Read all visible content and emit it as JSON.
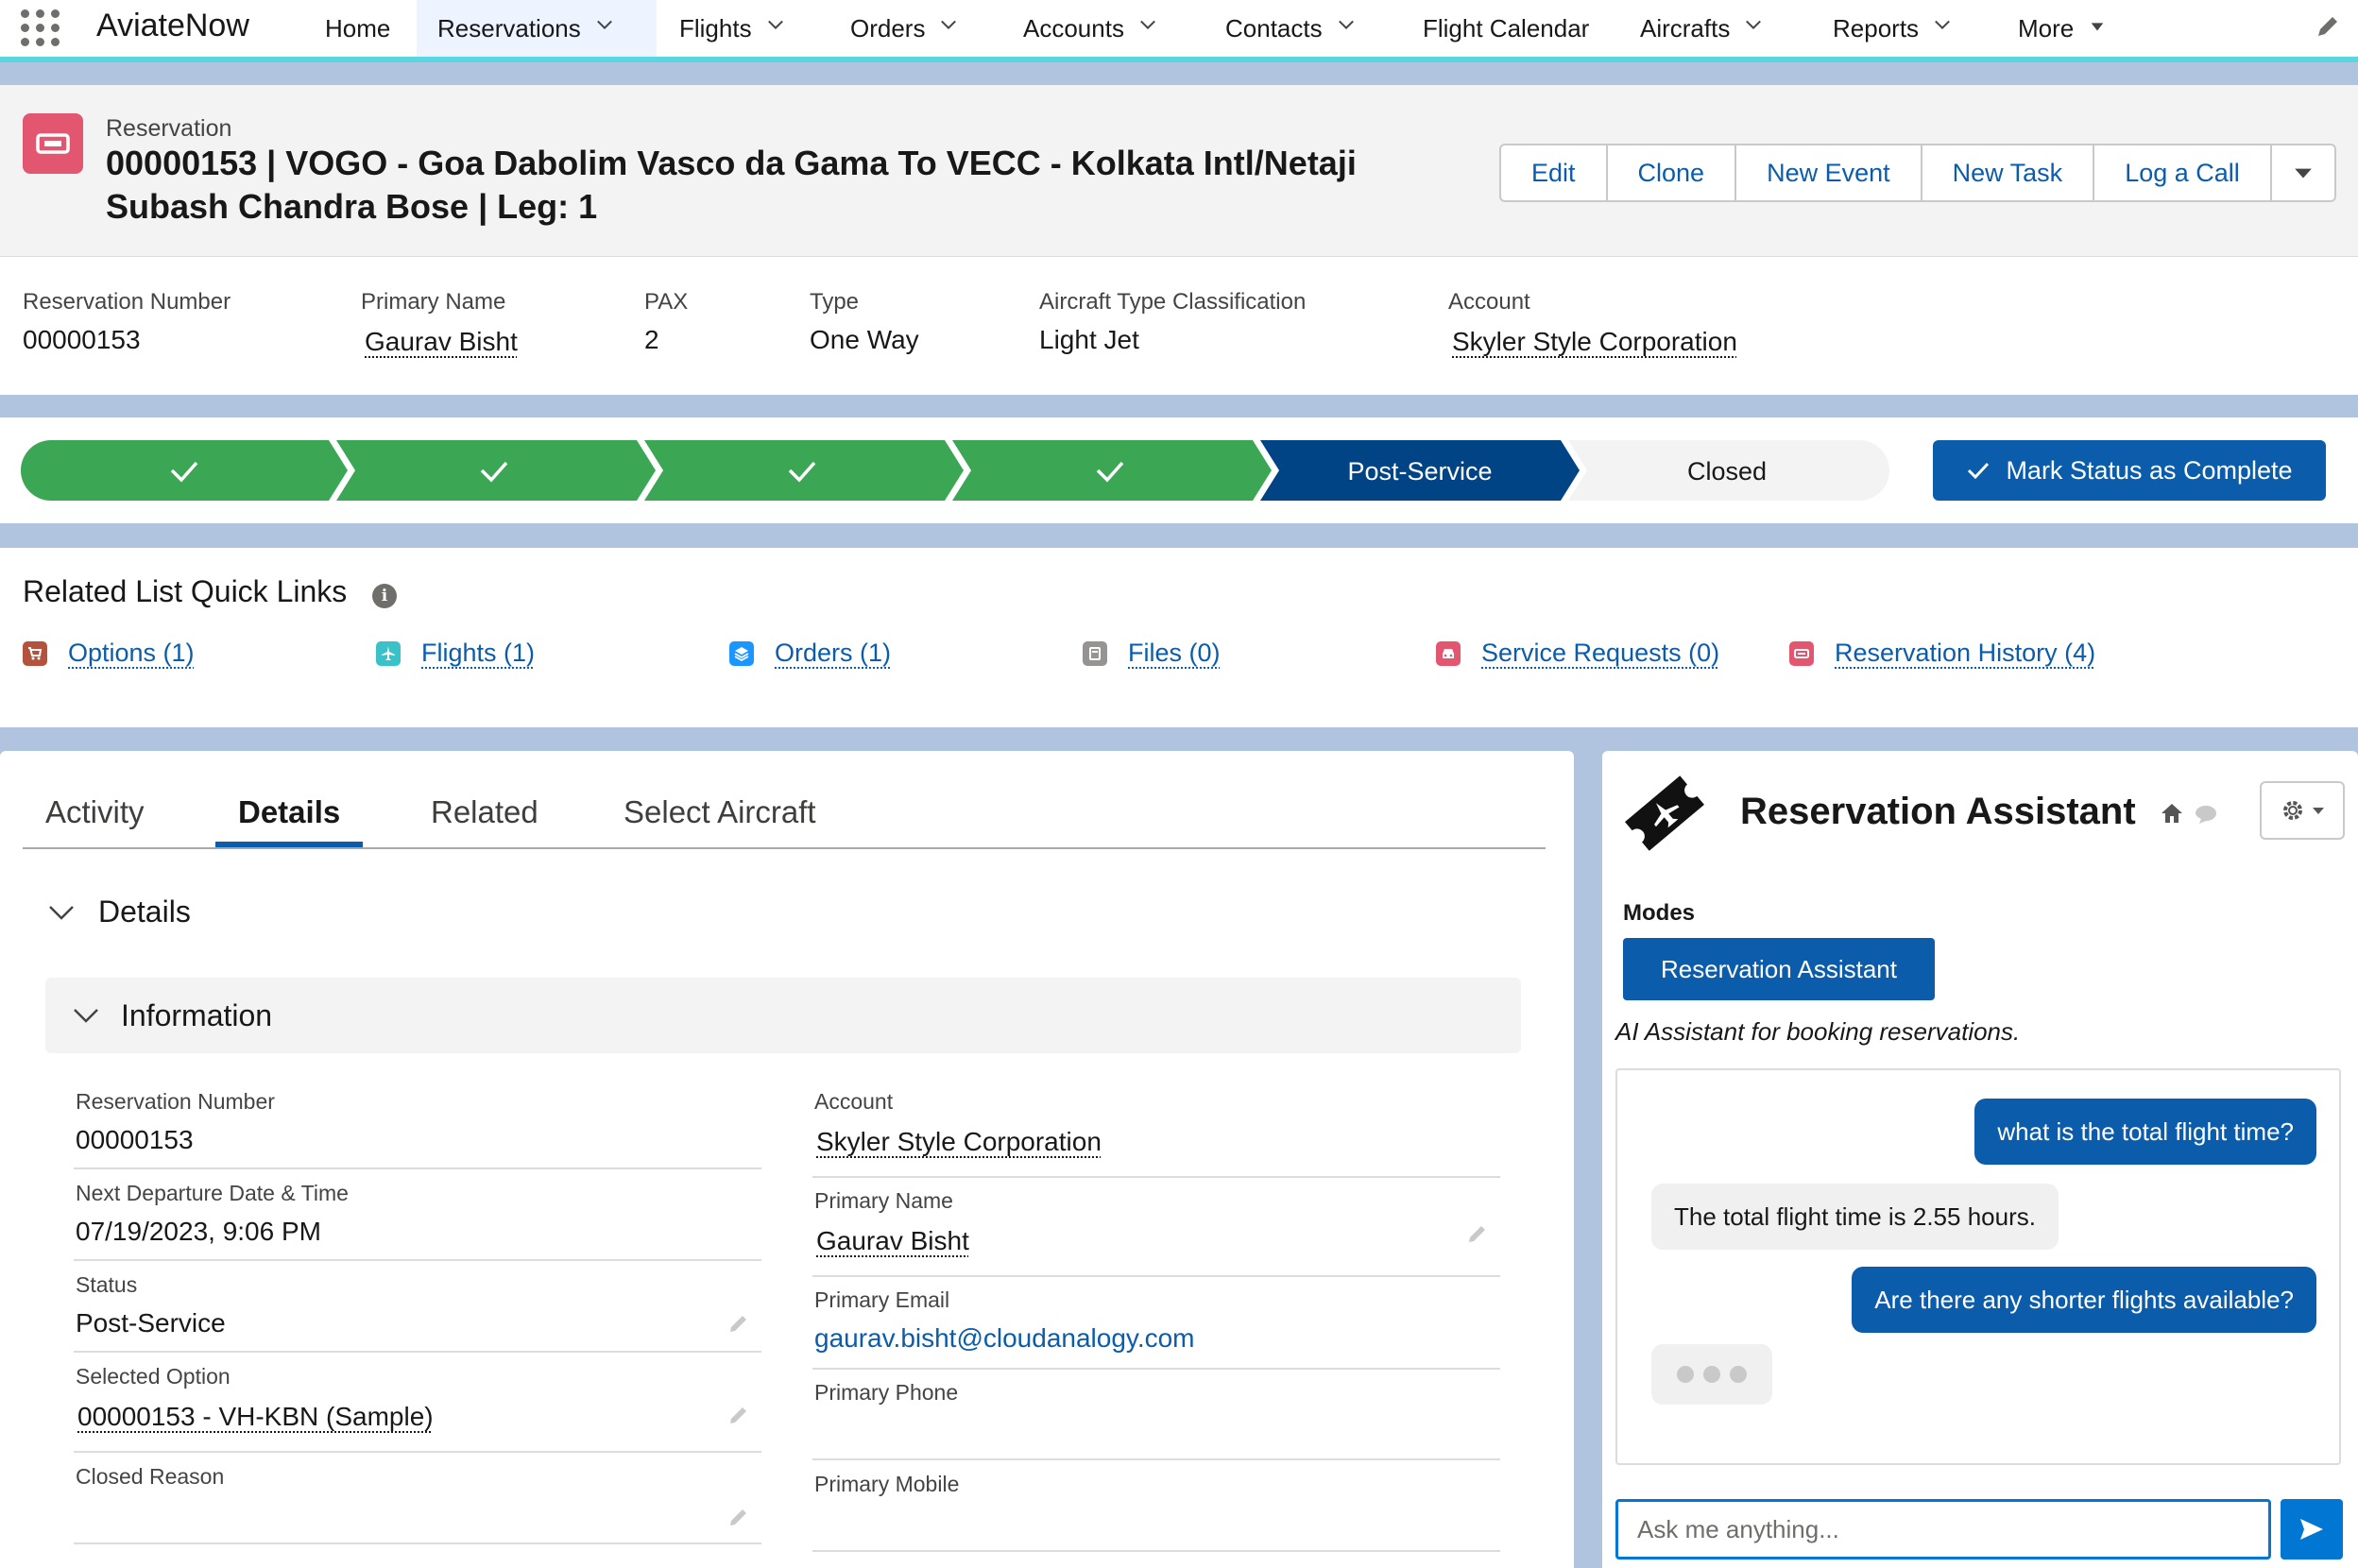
{
  "app": {
    "name": "AviateNow"
  },
  "nav": {
    "items": [
      {
        "label": "Home",
        "dropdown": false
      },
      {
        "label": "Reservations",
        "dropdown": true
      },
      {
        "label": "Flights",
        "dropdown": true
      },
      {
        "label": "Orders",
        "dropdown": true
      },
      {
        "label": "Accounts",
        "dropdown": true
      },
      {
        "label": "Contacts",
        "dropdown": true
      },
      {
        "label": "Flight Calendar",
        "dropdown": false
      },
      {
        "label": "Aircrafts",
        "dropdown": true
      },
      {
        "label": "Reports",
        "dropdown": true
      },
      {
        "label": "More",
        "dropdown": true
      }
    ],
    "active": "Reservations"
  },
  "record": {
    "object_label": "Reservation",
    "title": "00000153 | VOGO - Goa Dabolim Vasco da Gama To VECC - Kolkata Intl/Netaji Subash Chandra Bose | Leg: 1",
    "icon": "reservation-icon",
    "icon_color": "#e3566f"
  },
  "actions": [
    "Edit",
    "Clone",
    "New Event",
    "New Task",
    "Log a Call"
  ],
  "highlights": {
    "reservation_number": {
      "label": "Reservation Number",
      "value": "00000153"
    },
    "primary_name": {
      "label": "Primary Name",
      "value": "Gaurav Bisht"
    },
    "pax": {
      "label": "PAX",
      "value": "2"
    },
    "type": {
      "label": "Type",
      "value": "One Way"
    },
    "aircraft_type": {
      "label": "Aircraft Type Classification",
      "value": "Light Jet"
    },
    "account": {
      "label": "Account",
      "value": "Skyler Style Corporation"
    }
  },
  "path": {
    "completed_steps": 4,
    "current": "Post-Service",
    "next": "Closed",
    "mark_complete_label": "Mark Status as Complete",
    "colors": {
      "complete": "#3ba755",
      "current": "#014486",
      "incomplete": "#f3f3f3"
    }
  },
  "quick_links": {
    "title": "Related List Quick Links",
    "items": [
      {
        "label": "Options (1)",
        "icon": "cart-icon",
        "color": "#b4533d"
      },
      {
        "label": "Flights (1)",
        "icon": "airplane-icon",
        "color": "#3bc2c9"
      },
      {
        "label": "Orders (1)",
        "icon": "layers-icon",
        "color": "#1b96ff"
      },
      {
        "label": "Files (0)",
        "icon": "file-icon",
        "color": "#969492"
      },
      {
        "label": "Service Requests (0)",
        "icon": "car-icon",
        "color": "#e3566f"
      },
      {
        "label": "Reservation History (4)",
        "icon": "reservation-icon",
        "color": "#e3566f"
      }
    ]
  },
  "tabs": [
    "Activity",
    "Details",
    "Related",
    "Select Aircraft"
  ],
  "active_tab": "Details",
  "details": {
    "section": "Details",
    "subsection": "Information",
    "left": [
      {
        "label": "Reservation Number",
        "value": "00000153",
        "link": false,
        "editable": false
      },
      {
        "label": "Next Departure Date & Time",
        "value": "07/19/2023, 9:06 PM",
        "link": false,
        "editable": false
      },
      {
        "label": "Status",
        "value": "Post-Service",
        "link": false,
        "editable": true
      },
      {
        "label": "Selected Option",
        "value": "00000153 - VH-KBN (Sample)",
        "link": true,
        "editable": true
      },
      {
        "label": "Closed Reason",
        "value": "",
        "link": false,
        "editable": true
      }
    ],
    "right": [
      {
        "label": "Account",
        "value": "Skyler Style Corporation",
        "link": true,
        "editable": false
      },
      {
        "label": "Primary Name",
        "value": "Gaurav Bisht",
        "link": true,
        "editable": true
      },
      {
        "label": "Primary Email",
        "value": "gaurav.bisht@cloudanalogy.com",
        "link": "email",
        "editable": false
      },
      {
        "label": "Primary Phone",
        "value": "",
        "link": false,
        "editable": false
      },
      {
        "label": "Primary Mobile",
        "value": "",
        "link": false,
        "editable": false
      }
    ]
  },
  "assistant": {
    "title": "Reservation Assistant",
    "modes_label": "Modes",
    "mode_button": "Reservation Assistant",
    "description": "AI Assistant for booking reservations.",
    "messages": [
      {
        "from": "user",
        "text": "what is the total flight time?"
      },
      {
        "from": "bot",
        "text": "The total flight time is 2.55 hours."
      },
      {
        "from": "user",
        "text": "Are there any shorter flights available?"
      }
    ],
    "typing": true,
    "input_placeholder": "Ask me anything..."
  }
}
